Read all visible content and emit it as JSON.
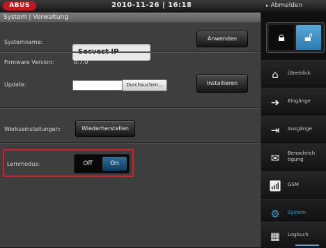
{
  "header": {
    "logo": "ABUS",
    "datetime": "2010-11-26 | 16:18",
    "logout": "Abmelden"
  },
  "breadcrumb": "System | Verwaltung",
  "form": {
    "systemname_label": "Systemname:",
    "systemname_value": "Secvest IP",
    "apply_button": "Anwenden",
    "firmware_label": "Firmware Version:",
    "firmware_value": "0.7.0",
    "update_label": "Update:",
    "file_value": "",
    "browse_button": "Durchsuchen...",
    "install_button": "Installieren",
    "factory_label": "Werkseinstellungen:",
    "factory_button": "Wiederherstellen",
    "learn_label": "Lernmodus:",
    "toggle_off": "Off",
    "toggle_on": "On",
    "toggle_state": "On"
  },
  "sidebar": {
    "items": [
      {
        "label": "Überblick",
        "icon": "house-icon"
      },
      {
        "label": "Eingänge",
        "icon": "enter-icon"
      },
      {
        "label": "Ausgänge",
        "icon": "exit-icon"
      },
      {
        "label": "Benachrichtigung",
        "label_line1": "Benachrich",
        "label_line2": "tigung",
        "icon": "envelope-icon"
      },
      {
        "label": "GSM",
        "icon": "signal-icon"
      },
      {
        "label": "System",
        "icon": "wrench-icon",
        "active": true
      },
      {
        "label": "Logbuch",
        "icon": "logbook-icon"
      }
    ]
  },
  "colors": {
    "accent": "#3c9ad6",
    "highlight_border": "#d4202a",
    "logo_red": "#c0181e"
  }
}
